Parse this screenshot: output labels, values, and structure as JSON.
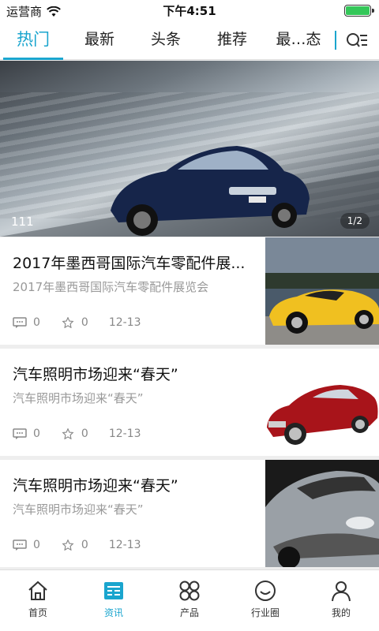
{
  "status": {
    "carrier": "运营商",
    "time": "下午4:51"
  },
  "tabs": [
    {
      "label": "热门",
      "active": true
    },
    {
      "label": "最新",
      "active": false
    },
    {
      "label": "头条",
      "active": false
    },
    {
      "label": "推荐",
      "active": false
    },
    {
      "label": "最…态",
      "active": false
    }
  ],
  "banner": {
    "caption": "111",
    "pager": "1/2"
  },
  "news": [
    {
      "title": "2017年墨西哥国际汽车零配件展...",
      "summary": "2017年墨西哥国际汽车零配件展览会",
      "comments": "0",
      "stars": "0",
      "date": "12-13"
    },
    {
      "title": "汽车照明市场迎来“春天”",
      "summary": "汽车照明市场迎来“春天”",
      "comments": "0",
      "stars": "0",
      "date": "12-13"
    },
    {
      "title": "汽车照明市场迎来“春天”",
      "summary": "汽车照明市场迎来“春天”",
      "comments": "0",
      "stars": "0",
      "date": "12-13"
    }
  ],
  "bottom_nav": [
    {
      "label": "首页",
      "icon": "home-icon",
      "active": false
    },
    {
      "label": "资讯",
      "icon": "news-icon",
      "active": true
    },
    {
      "label": "产品",
      "icon": "grid-icon",
      "active": false
    },
    {
      "label": "行业圈",
      "icon": "circle-face-icon",
      "active": false
    },
    {
      "label": "我的",
      "icon": "person-icon",
      "active": false
    }
  ],
  "colors": {
    "accent": "#1aa5ce",
    "battery": "#34c759"
  }
}
